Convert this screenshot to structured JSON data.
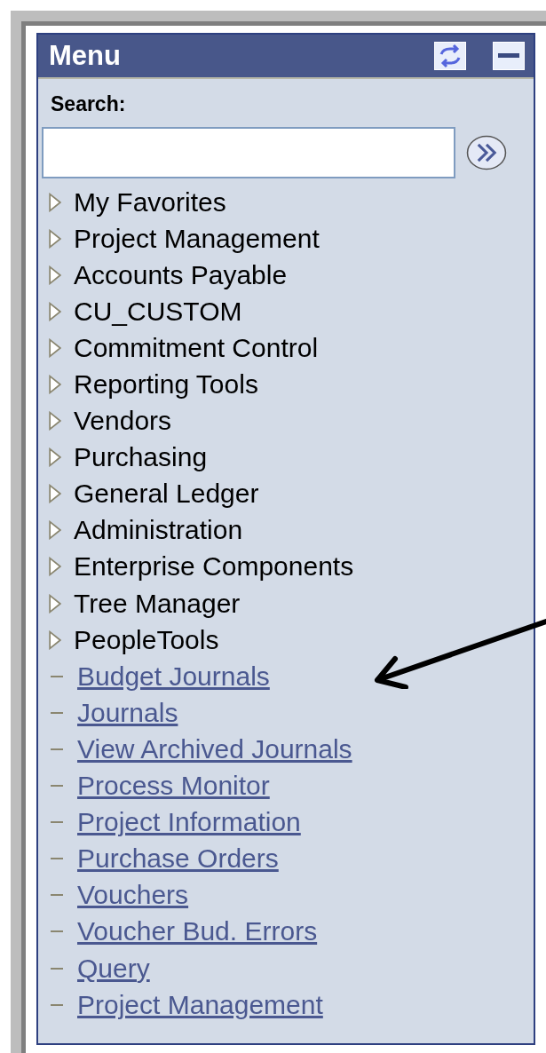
{
  "menu": {
    "title": "Menu",
    "search_label": "Search:",
    "items": [
      {
        "kind": "folder",
        "label": "My Favorites"
      },
      {
        "kind": "folder",
        "label": "Project Management"
      },
      {
        "kind": "folder",
        "label": "Accounts Payable"
      },
      {
        "kind": "folder",
        "label": "CU_CUSTOM"
      },
      {
        "kind": "folder",
        "label": "Commitment Control"
      },
      {
        "kind": "folder",
        "label": "Reporting Tools"
      },
      {
        "kind": "folder",
        "label": "Vendors"
      },
      {
        "kind": "folder",
        "label": "Purchasing"
      },
      {
        "kind": "folder",
        "label": "General Ledger"
      },
      {
        "kind": "folder",
        "label": "Administration"
      },
      {
        "kind": "folder",
        "label": "Enterprise Components"
      },
      {
        "kind": "folder",
        "label": "Tree Manager"
      },
      {
        "kind": "folder",
        "label": "PeopleTools"
      },
      {
        "kind": "link",
        "label": "Budget Journals"
      },
      {
        "kind": "link",
        "label": "Journals"
      },
      {
        "kind": "link",
        "label": "View Archived Journals"
      },
      {
        "kind": "link",
        "label": "Process Monitor"
      },
      {
        "kind": "link",
        "label": "Project Information"
      },
      {
        "kind": "link",
        "label": "Purchase Orders"
      },
      {
        "kind": "link",
        "label": "Vouchers"
      },
      {
        "kind": "link",
        "label": "Voucher Bud. Errors"
      },
      {
        "kind": "link",
        "label": "Query"
      },
      {
        "kind": "link",
        "label": "Project Management"
      }
    ]
  }
}
